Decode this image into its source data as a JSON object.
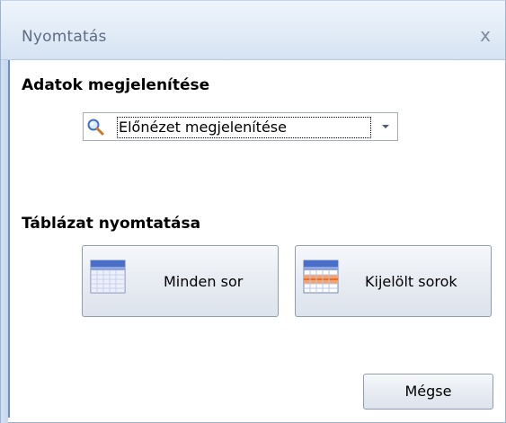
{
  "window": {
    "title": "Nyomtatás",
    "close_label": "x"
  },
  "data_section": {
    "heading": "Adatok megjelenítése",
    "dropdown": {
      "selected": "Előnézet megjelenítése",
      "icon": "magnifier-icon"
    }
  },
  "print_section": {
    "heading": "Táblázat nyomtatása",
    "buttons": [
      {
        "label": "Minden sor",
        "icon": "table-icon"
      },
      {
        "label": "Kijelölt sorok",
        "icon": "table-selected-rows-icon"
      }
    ]
  },
  "footer": {
    "cancel_label": "Mégse"
  },
  "colors": {
    "title_text": "#5d6d82",
    "accent_border": "#6b8fc1",
    "selection_band": "#e8702a"
  }
}
